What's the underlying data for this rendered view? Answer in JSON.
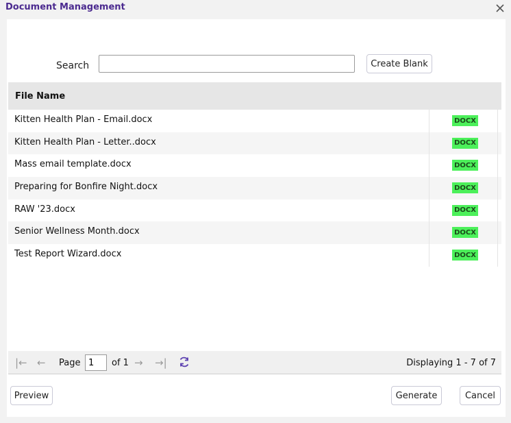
{
  "window": {
    "title": "Document Management",
    "close_icon": "close-icon"
  },
  "search": {
    "label": "Search",
    "value": "",
    "placeholder": ""
  },
  "buttons": {
    "create_blank": "Create Blank",
    "preview": "Preview",
    "generate": "Generate",
    "cancel": "Cancel"
  },
  "grid": {
    "columns": [
      "File Name",
      ""
    ],
    "rows": [
      {
        "name": "Kitten Health Plan - Email.docx",
        "type": "DOCX"
      },
      {
        "name": "Kitten Health Plan - Letter..docx",
        "type": "DOCX"
      },
      {
        "name": "Mass email template.docx",
        "type": "DOCX"
      },
      {
        "name": "Preparing for Bonfire Night.docx",
        "type": "DOCX"
      },
      {
        "name": "RAW '23.docx",
        "type": "DOCX"
      },
      {
        "name": "Senior Wellness Month.docx",
        "type": "DOCX"
      },
      {
        "name": "Test Report Wizard.docx",
        "type": "DOCX"
      }
    ]
  },
  "pager": {
    "page_label": "Page",
    "page_value": "1",
    "of_label": "of 1",
    "displaying": "Displaying 1 - 7 of 7"
  },
  "colors": {
    "title": "#4b2a8f",
    "badge": "#4cf05a",
    "refresh": "#5b3fb0"
  }
}
